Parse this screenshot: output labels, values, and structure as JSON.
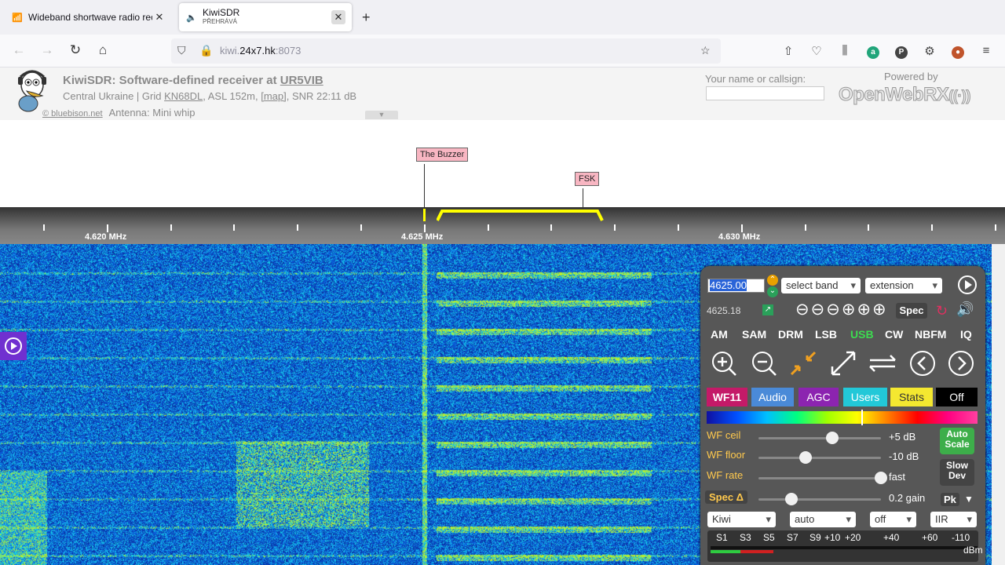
{
  "browser": {
    "tabs": [
      {
        "title": "Wideband shortwave radio rece",
        "icon": "radio-tower-icon"
      },
      {
        "title": "KiwiSDR",
        "subtitle": "PŘEHRÁVÁ",
        "icon": "speaker-icon"
      }
    ],
    "url_host": "kiwi.",
    "url_domain": "24x7.hk",
    "url_port": ":8073"
  },
  "header": {
    "title": "KiwiSDR: Software-defined receiver at",
    "callsign_link": "UR5VIB",
    "location": "Central Ukraine | Grid",
    "grid": "KN68DL",
    "asl": ", ASL 152m,",
    "map": "[map]",
    "snr": ", SNR 22:11 dB",
    "credit": "© bluebison.net",
    "antenna": "Antenna: Mini whip",
    "callsign_label": "Your name or callsign:",
    "powered_by": "Powered by",
    "brand": "OpenWebRX"
  },
  "spectrum": {
    "markers": [
      "The Buzzer",
      "FSK"
    ],
    "freq_labels": [
      "4.620 MHz",
      "4.625 MHz",
      "4.630 MHz"
    ]
  },
  "panel": {
    "freq_input": "4625.00",
    "freq_readout": "4625.18",
    "band_select": "select band",
    "extension_select": "extension",
    "spec_label": "Spec",
    "modes": [
      "AM",
      "SAM",
      "DRM",
      "LSB",
      "USB",
      "CW",
      "NBFM",
      "IQ"
    ],
    "active_mode": "USB",
    "tabs": [
      "WF11",
      "Audio",
      "AGC",
      "Users",
      "Stats",
      "Off"
    ],
    "sliders": [
      {
        "label": "WF ceil",
        "value": "+5 dB",
        "level": 0.58
      },
      {
        "label": "WF floor",
        "value": "-10 dB",
        "level": 0.35
      },
      {
        "label": "WF rate",
        "value": "fast",
        "level": 1.0
      },
      {
        "label": "Spec Δ",
        "value": "0.2 gain",
        "level": 0.23
      }
    ],
    "auto_scale": "Auto Scale",
    "slow_dev": "Slow Dev",
    "pk": "Pk",
    "bottom_selects": [
      "Kiwi",
      "auto",
      "off",
      "IIR"
    ],
    "smeter_labels": [
      "S1",
      "S3",
      "S5",
      "S7",
      "S9",
      "+10",
      "+20",
      "+40",
      "+60",
      "-110"
    ],
    "smeter_unit": "dBm"
  }
}
